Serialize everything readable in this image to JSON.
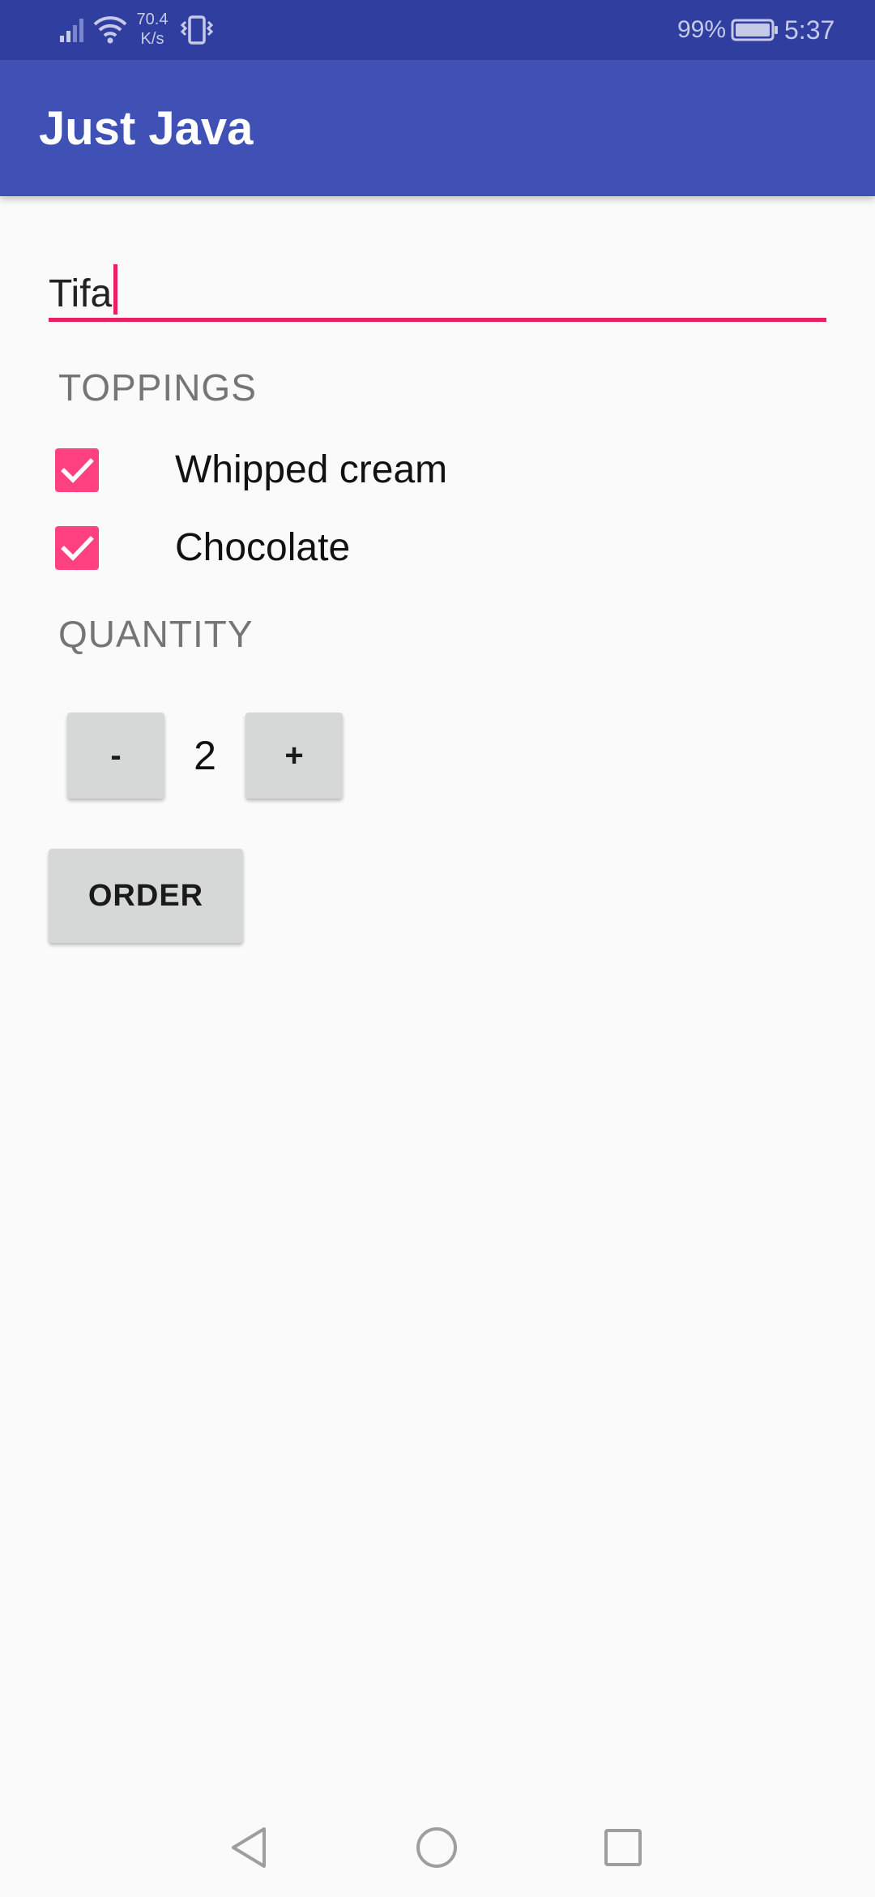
{
  "status_bar": {
    "network_speed_value": "70.4",
    "network_speed_unit": "K/s",
    "battery_percent": "99%",
    "time": "5:37",
    "icons": [
      "cell-signal-icon",
      "wifi-icon",
      "vibrate-icon",
      "battery-icon"
    ]
  },
  "app_bar": {
    "title": "Just Java",
    "color": "#3F51B5"
  },
  "name_input": {
    "value": "Tifa",
    "accent_color": "#E91E63"
  },
  "toppings": {
    "header": "TOPPINGS",
    "items": [
      {
        "label": "Whipped cream",
        "checked": true
      },
      {
        "label": "Chocolate",
        "checked": true
      }
    ],
    "checkbox_color": "#FF4081"
  },
  "quantity": {
    "header": "QUANTITY",
    "decrement_label": "-",
    "value": "2",
    "increment_label": "+"
  },
  "order_button": {
    "label": "ORDER"
  },
  "nav_bar": {
    "icons": [
      "back-icon",
      "home-icon",
      "recent-apps-icon"
    ]
  }
}
